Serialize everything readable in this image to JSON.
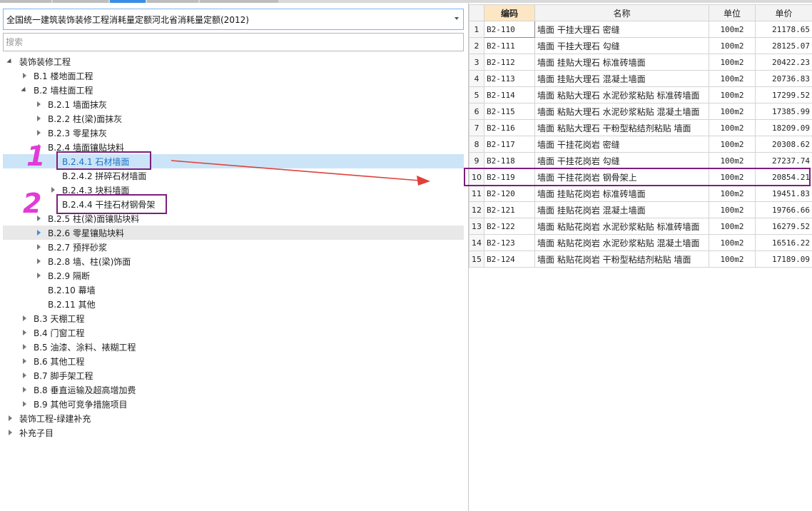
{
  "dropdown": {
    "value": "全国统一建筑装饰装修工程消耗量定额河北省消耗量定额(2012)"
  },
  "search": {
    "placeholder": "搜索"
  },
  "tree": [
    {
      "label": "装饰装修工程",
      "level": 0,
      "state": "expanded"
    },
    {
      "label": "B.1 楼地面工程",
      "level": 1,
      "state": "collapsed"
    },
    {
      "label": "B.2 墙柱面工程",
      "level": 1,
      "state": "expanded"
    },
    {
      "label": "B.2.1 墙面抹灰",
      "level": 2,
      "state": "collapsed"
    },
    {
      "label": "B.2.2 柱(梁)面抹灰",
      "level": 2,
      "state": "collapsed"
    },
    {
      "label": "B.2.3 零星抹灰",
      "level": 2,
      "state": "collapsed"
    },
    {
      "label": "B.2.4 墙面镶贴块料",
      "level": 2,
      "state": "expanded"
    },
    {
      "label": "B.2.4.1 石材墙面",
      "level": 3,
      "state": "leaf",
      "selected": true
    },
    {
      "label": "B.2.4.2 拼碎石材墙面",
      "level": 3,
      "state": "leaf"
    },
    {
      "label": "B.2.4.3 块料墙面",
      "level": 3,
      "state": "collapsed"
    },
    {
      "label": "B.2.4.4 干挂石材钢骨架",
      "level": 3,
      "state": "leaf"
    },
    {
      "label": "B.2.5 柱(梁)面镶贴块料",
      "level": 2,
      "state": "collapsed"
    },
    {
      "label": "B.2.6 零星镶贴块料",
      "level": 2,
      "state": "collapsed",
      "hover": true
    },
    {
      "label": "B.2.7 预拌砂浆",
      "level": 2,
      "state": "collapsed"
    },
    {
      "label": "B.2.8 墙、柱(梁)饰面",
      "level": 2,
      "state": "collapsed"
    },
    {
      "label": "B.2.9 隔断",
      "level": 2,
      "state": "collapsed"
    },
    {
      "label": "B.2.10 幕墙",
      "level": 2,
      "state": "leaf"
    },
    {
      "label": "B.2.11 其他",
      "level": 2,
      "state": "leaf"
    },
    {
      "label": "B.3 天棚工程",
      "level": 1,
      "state": "collapsed"
    },
    {
      "label": "B.4 门窗工程",
      "level": 1,
      "state": "collapsed"
    },
    {
      "label": "B.5 油漆、涂料、裱糊工程",
      "level": 1,
      "state": "collapsed"
    },
    {
      "label": "B.6 其他工程",
      "level": 1,
      "state": "collapsed"
    },
    {
      "label": "B.7 脚手架工程",
      "level": 1,
      "state": "collapsed"
    },
    {
      "label": "B.8 垂直运输及超高增加费",
      "level": 1,
      "state": "collapsed"
    },
    {
      "label": "B.9 其他可竞争措施项目",
      "level": 1,
      "state": "collapsed"
    },
    {
      "label": "装饰工程-绿建补充",
      "level": 0,
      "state": "collapsed"
    },
    {
      "label": "补充子目",
      "level": 0,
      "state": "collapsed"
    }
  ],
  "annotations": {
    "one": "1",
    "two": "2"
  },
  "grid": {
    "headers": {
      "rownum": "",
      "code": "编码",
      "name": "名称",
      "unit": "单位",
      "price": "单价"
    },
    "rows": [
      {
        "n": "1",
        "code": "B2-110",
        "name": "墙面 干挂大理石 密缝",
        "unit": "100m2",
        "price": "21178.65"
      },
      {
        "n": "2",
        "code": "B2-111",
        "name": "墙面 干挂大理石 勾缝",
        "unit": "100m2",
        "price": "28125.07"
      },
      {
        "n": "3",
        "code": "B2-112",
        "name": "墙面 挂贴大理石 标准砖墙面",
        "unit": "100m2",
        "price": "20422.23"
      },
      {
        "n": "4",
        "code": "B2-113",
        "name": "墙面 挂贴大理石 混凝土墙面",
        "unit": "100m2",
        "price": "20736.83"
      },
      {
        "n": "5",
        "code": "B2-114",
        "name": "墙面 粘贴大理石 水泥砂浆粘贴 标准砖墙面",
        "unit": "100m2",
        "price": "17299.52"
      },
      {
        "n": "6",
        "code": "B2-115",
        "name": "墙面 粘贴大理石 水泥砂浆粘贴 混凝土墙面",
        "unit": "100m2",
        "price": "17385.99"
      },
      {
        "n": "7",
        "code": "B2-116",
        "name": "墙面 粘贴大理石 干粉型粘结剂粘贴 墙面",
        "unit": "100m2",
        "price": "18209.09"
      },
      {
        "n": "8",
        "code": "B2-117",
        "name": "墙面 干挂花岗岩 密缝",
        "unit": "100m2",
        "price": "20308.62"
      },
      {
        "n": "9",
        "code": "B2-118",
        "name": "墙面 干挂花岗岩 勾缝",
        "unit": "100m2",
        "price": "27237.74"
      },
      {
        "n": "10",
        "code": "B2-119",
        "name": "墙面 干挂花岗岩 钢骨架上",
        "unit": "100m2",
        "price": "20854.21"
      },
      {
        "n": "11",
        "code": "B2-120",
        "name": "墙面 挂贴花岗岩 标准砖墙面",
        "unit": "100m2",
        "price": "19451.83"
      },
      {
        "n": "12",
        "code": "B2-121",
        "name": "墙面 挂贴花岗岩 混凝土墙面",
        "unit": "100m2",
        "price": "19766.66"
      },
      {
        "n": "13",
        "code": "B2-122",
        "name": "墙面 粘贴花岗岩 水泥砂浆粘贴 标准砖墙面",
        "unit": "100m2",
        "price": "16279.52"
      },
      {
        "n": "14",
        "code": "B2-123",
        "name": "墙面 粘贴花岗岩 水泥砂浆粘贴 混凝土墙面",
        "unit": "100m2",
        "price": "16516.22"
      },
      {
        "n": "15",
        "code": "B2-124",
        "name": "墙面 粘贴花岗岩 干粉型粘结剂粘贴 墙面",
        "unit": "100m2",
        "price": "17189.09"
      }
    ]
  },
  "colors": {
    "annotation_box": "#7b1f7d",
    "annotation_number": "#e23ad7",
    "arrow": "#e0403a",
    "selection": "#cce4f7",
    "sorted_header": "#fde6c3"
  },
  "icons": {
    "expand": "triangle-right-icon",
    "collapse": "triangle-down-icon",
    "dropdown": "chevron-down-icon"
  }
}
